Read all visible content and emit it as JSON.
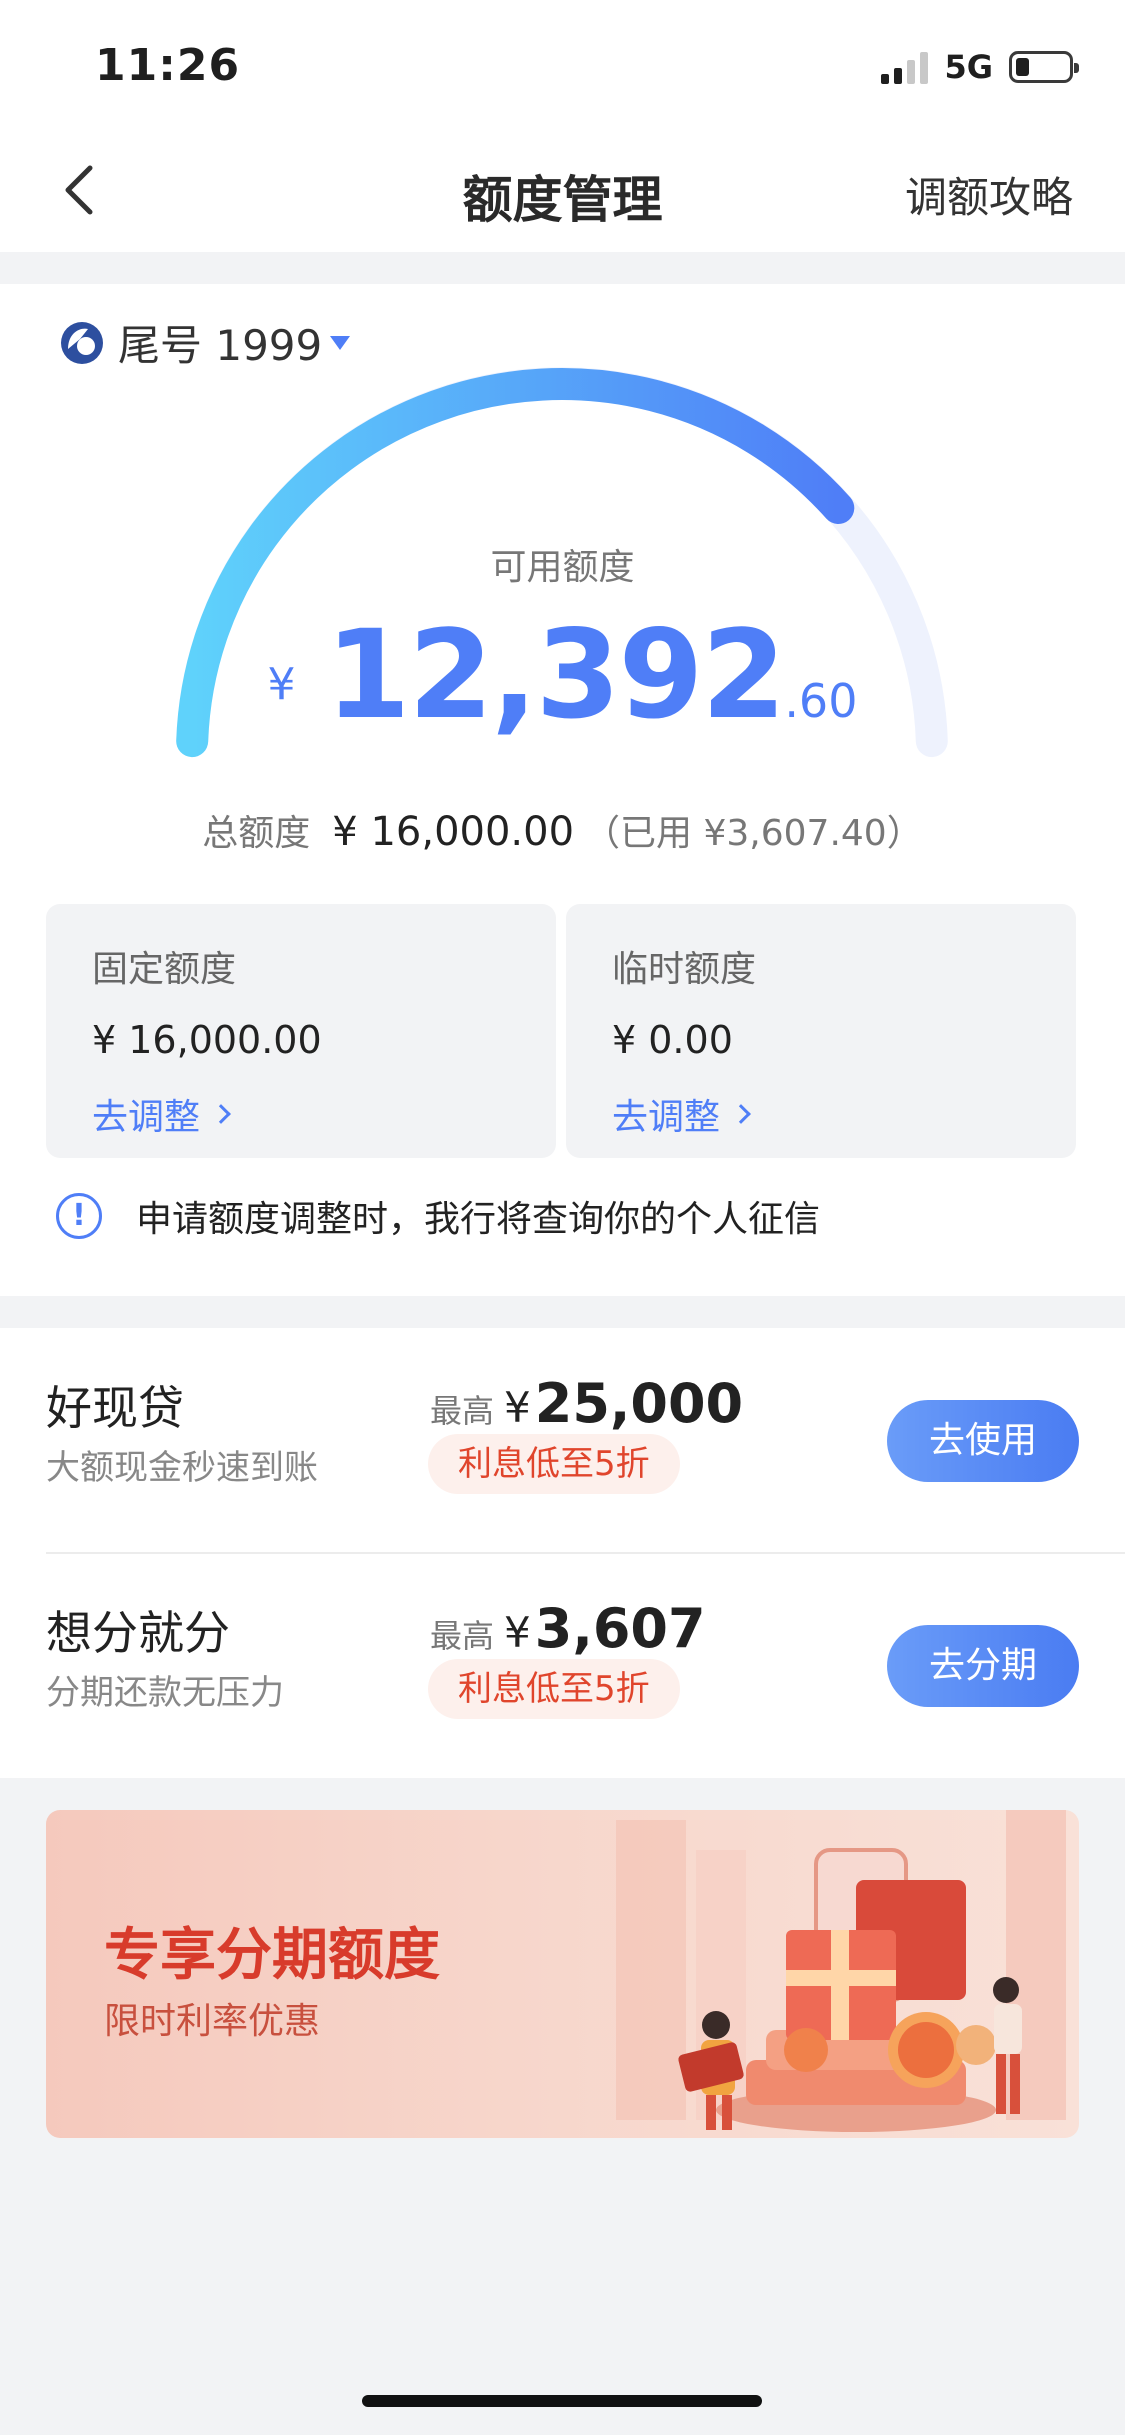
{
  "status_bar": {
    "time": "11:26",
    "network": "5G",
    "battery_level": 0.26
  },
  "nav": {
    "title": "额度管理",
    "action": "调额攻略",
    "back_icon": "chevron-left-icon"
  },
  "account": {
    "label": "尾号 1999",
    "logo_icon": "bank-logo-icon",
    "dropdown_icon": "caret-down-icon"
  },
  "gauge": {
    "caption": "可用额度",
    "currency": "¥",
    "amount_int": "12,392",
    "amount_dec": ".60",
    "available": 12392.6,
    "total": 16000.0,
    "used_fraction": 0.2255,
    "color_start": "#5fd2fb",
    "color_end": "#4f7ef7",
    "track_color": "#eef2fd"
  },
  "totals": {
    "label": "总额度",
    "total_value": "¥ 16,000.00",
    "used_text": "（已用 ¥3,607.40）"
  },
  "quotas": {
    "fixed": {
      "title": "固定额度",
      "value": "¥ 16,000.00",
      "link": "去调整"
    },
    "temp": {
      "title": "临时额度",
      "value": "¥ 0.00",
      "link": "去调整"
    }
  },
  "notice": {
    "icon": "info-icon",
    "text": "申请额度调整时，我行将查询你的个人征信"
  },
  "offers": [
    {
      "title": "好现贷",
      "subtitle": "大额现金秒速到账",
      "max_label": "最高",
      "currency": "¥",
      "max_value": "25,000",
      "tag": "利息低至5折",
      "button": "去使用"
    },
    {
      "title": "想分就分",
      "subtitle": "分期还款无压力",
      "max_label": "最高",
      "currency": "¥",
      "max_value": "3,607",
      "tag": "利息低至5折",
      "button": "去分期"
    }
  ],
  "banner": {
    "title": "专享分期额度",
    "subtitle": "限时利率优惠",
    "illustration": "gift-box-illustration"
  },
  "colors": {
    "accent": "#4f7ef7",
    "tag_red": "#e0452c",
    "banner_red": "#d83b2b"
  }
}
